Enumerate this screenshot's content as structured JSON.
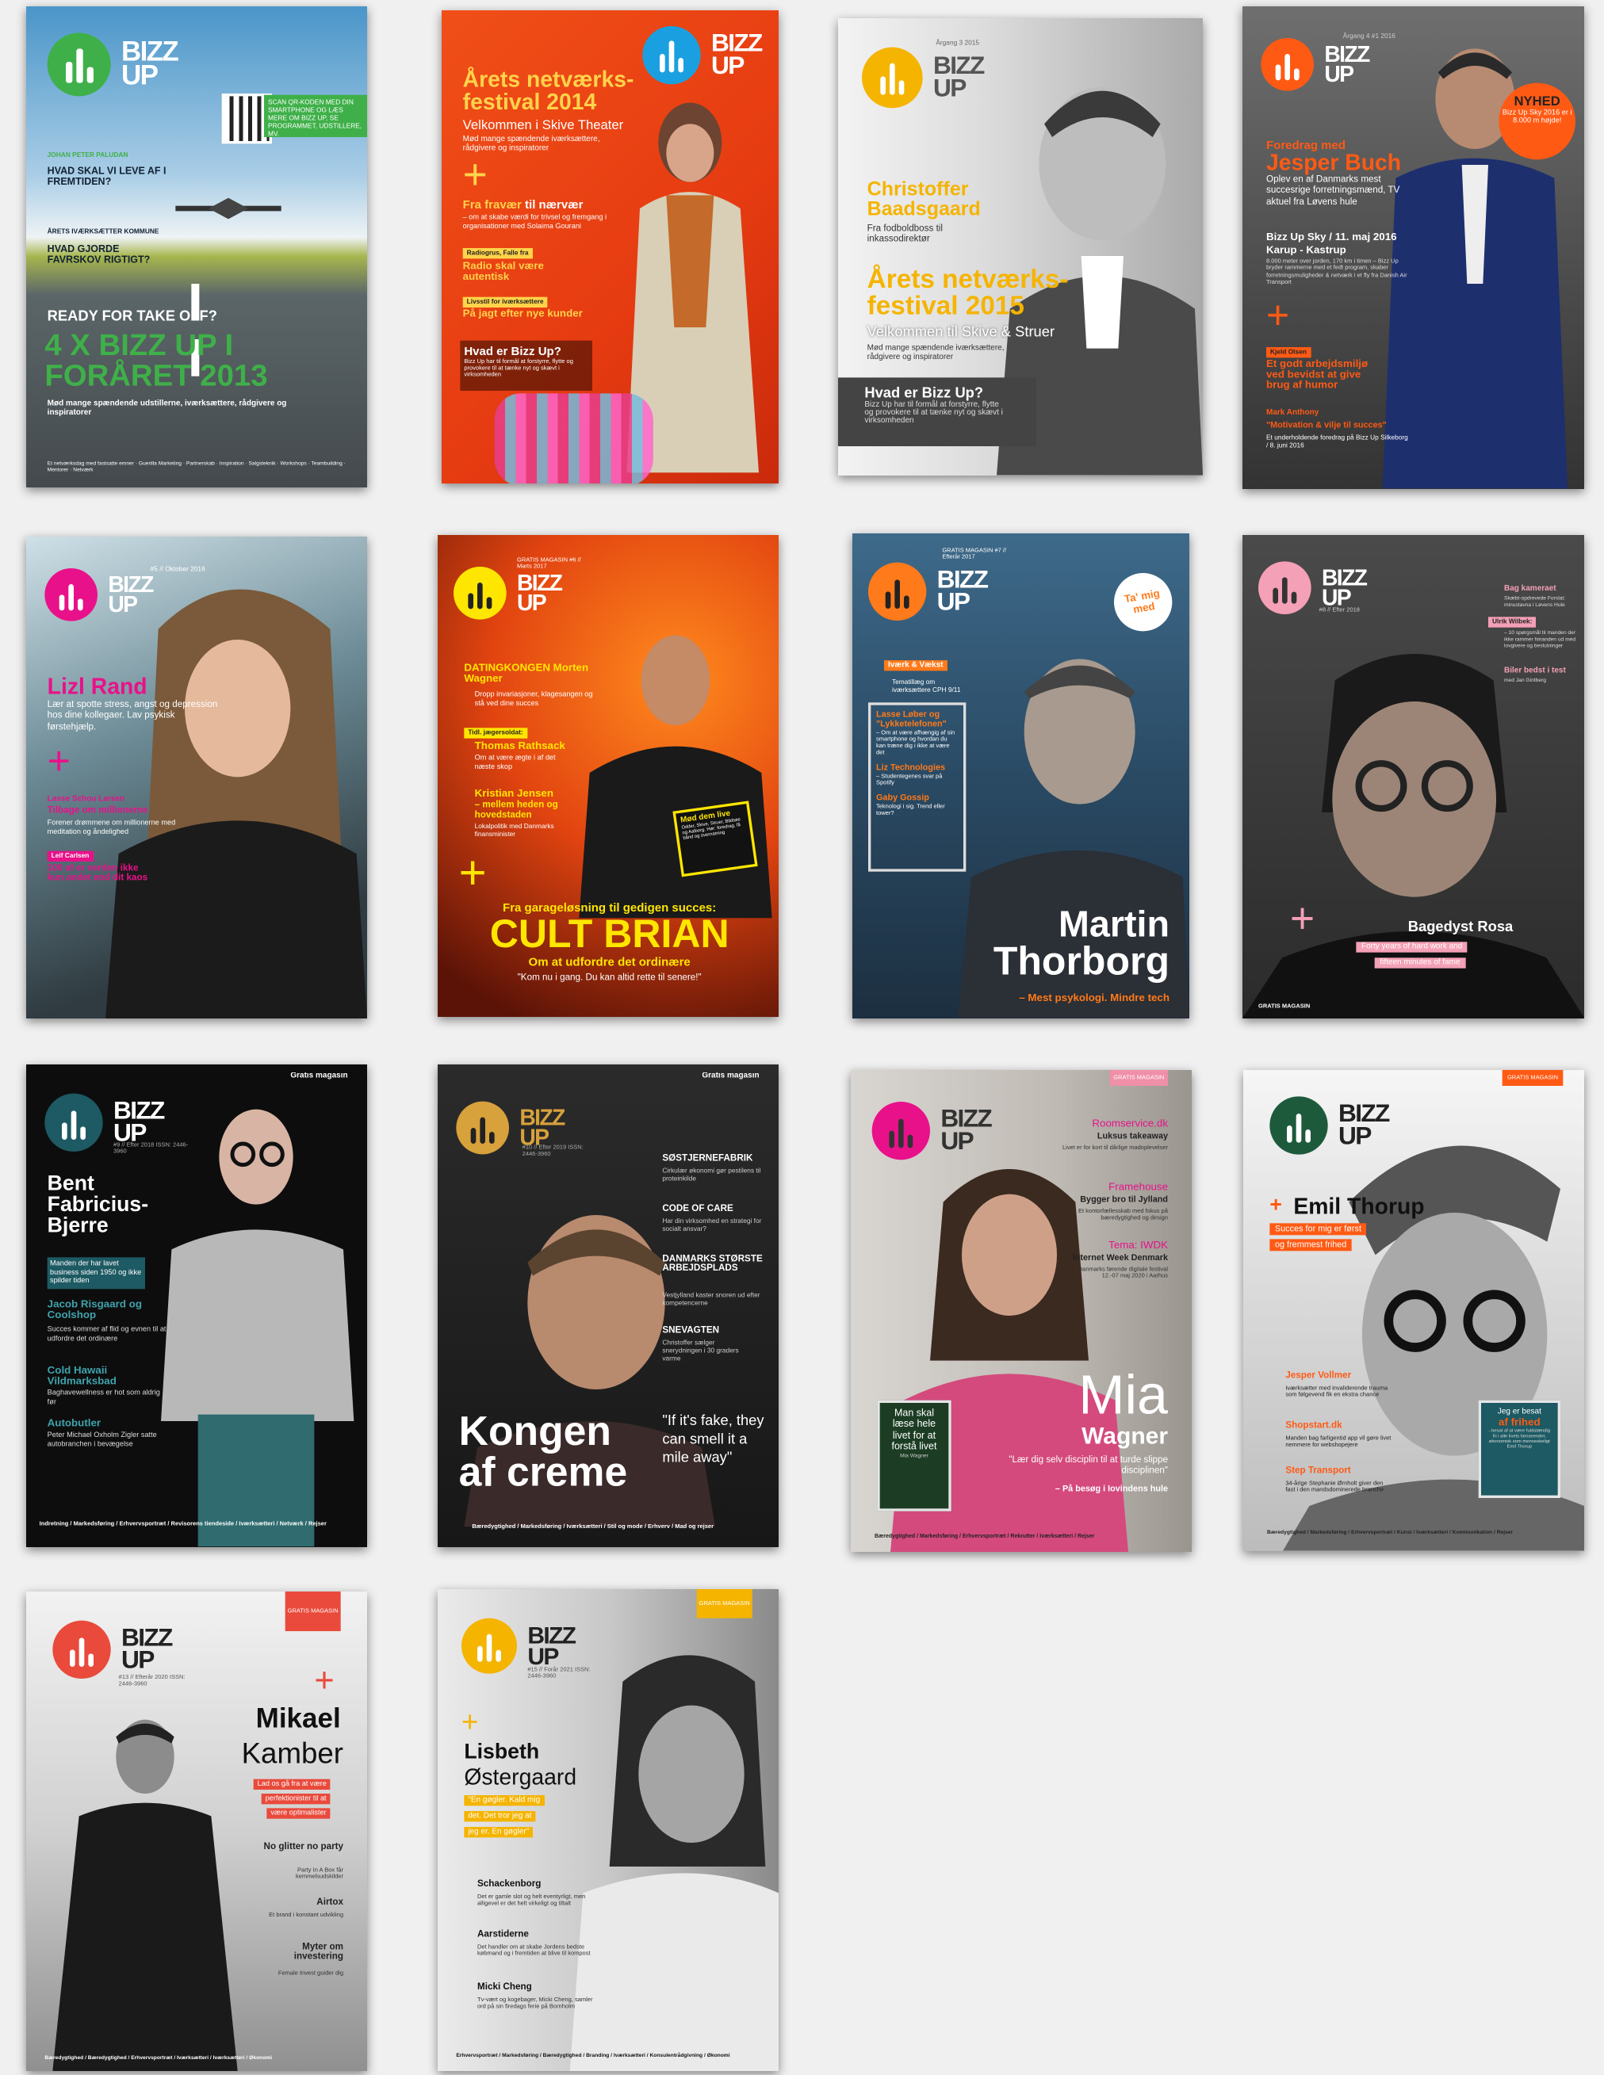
{
  "covers": [
    {
      "logo": "BIZZ\nUP",
      "qr_text": "SCAN QR-KODEN MED DIN SMARTPHONE OG LÆS MERE OM BIZZ UP, SE PROGRAMMET, UDSTILLERE, MV.",
      "byline": "JOHAN PETER PALUDAN",
      "q1": "HVAD SKAL VI LEVE AF I FREMTIDEN?",
      "kicker2": "ÅRETS IVÆRKSÆTTER KOMMUNE",
      "q2": "HVAD GJORDE FAVRSKOV RIGTIGT?",
      "tagline": "READY FOR TAKE OFF?",
      "headline": "4 X BIZZ UP I FORÅRET 2013",
      "sub": "Mød mange spændende udstillerne, iværksættere, rådgivere og inspiratorer",
      "footer": "Et netværksdag med fastsatte emner · Guerilla Marketing · Partnerskab · Inspiration · Salgsteknik · Workshops · Teambuilding · Mentorer · Netværk"
    },
    {
      "logo": "BIZZ\nUP",
      "headline": "Årets netværks-festival 2014",
      "sub": "Velkommen i Skive Theater",
      "sub2": "Mød mange spændende iværksættere, rådgivere og inspiratorer",
      "plus": "+",
      "l1a": "Fra fravær",
      "l1b": " til nærvær",
      "l1c": "– om at skabe værdi for trivsel og fremgang i organisationer med Solaima Gourani",
      "k2": "Radiogrus, Falle fra",
      "l2": "Radio skal være autentisk",
      "k3": "Livsstil for iværksættere",
      "l3": "På jagt efter nye kunder",
      "q": "Hvad er Bizz Up?",
      "qd": "Bizz Up har til formål at forstyrre, flytte og provokere til at tænke nyt og skævt i virksomheden"
    },
    {
      "logo": "BIZZ\nUP",
      "issue": "Årgang 3 2015",
      "name": "Christoffer Baadsgaard",
      "name_sub": "Fra fodboldboss til inkassodirektør",
      "headline": "Årets netværks-festival 2015",
      "sub": "Velkommen til Skive & Struer",
      "sub2": "Mød mange spændende iværksættere, rådgivere og inspiratorer",
      "q": "Hvad er Bizz Up?",
      "qd": "Bizz Up har til formål at forstyrre, flytte og provokere til at tænke nyt og skævt i virksomheden"
    },
    {
      "logo": "BIZZ\nUP",
      "issue": "Årgang 4 #1 2016",
      "badge1": "NYHED",
      "badge2": "Bizz Up Sky 2016 er i 8.000 m højde!",
      "kicker": "Foredrag med",
      "name": "Jesper Buch",
      "desc": "Oplev en af Danmarks mest succesrige forretningsmænd, TV aktuel fra Løvens hule",
      "event": "Bizz Up Sky / 11. maj 2016",
      "place": "Karup - Kastrup",
      "eventd": "8.000 meter over jorden, 170 km i timen – Bizz Up bryder rammerne med et fedt program, skaber forretningsmuligheder & netværk i et fly fra Danish Air Transport",
      "plus": "+",
      "k2": "Kjeld Olsen",
      "l2": "Et godt arbejdsmiljø ved bevidst at give brug af humor",
      "k3": "Mark Anthony",
      "l3": "\"Motivation & vilje til succes\"",
      "l3d": "Et underholdende foredrag på Bizz Up Silkeborg / 8. juni 2016"
    },
    {
      "logo": "BIZZ\nUP",
      "issue": "#5 // Oktober 2016",
      "name": "Lizl Rand",
      "desc": "Lær at spotte stress, angst og depression hos dine kollegaer. Lav psykisk førstehjælp.",
      "plus": "+",
      "k2": "Lasse Schou Larsen",
      "l2": "Tilbage om millionerne",
      "d2": "Forener drømmene om millionerne med meditation og åndelighed",
      "k3": "Leif Carlsen",
      "l3": "100 af er verden ikke kun andet end dit kaos"
    },
    {
      "logo": "BIZZ\nUP",
      "issue": "GRATIS MAGASIN #6 // Marts 2017",
      "l1": "DATINGKONGEN Morten Wagner",
      "l1d": "Dropp invariasjoner, klagesangen og stå ved dine succes",
      "k2": "Tidl. jægersoldat:",
      "l2": "Thomas Rathsack",
      "l2d": "Om at være ægte i af det næste skop",
      "l3": "Kristian Jensen",
      "l3b": "– mellem heden og hovedstaden",
      "l3d": "Lokalpolitik med Danmarks finansminister",
      "meet": "Mød dem live",
      "meetd": "Odder, Skive, Struer, Bildsøe og Aalborg. Hør: foredrag, få bånd og overnatning",
      "plus": "+",
      "kicker": "Fra garageløsning til gedigen succes:",
      "headline": "CULT BRIAN",
      "sub": "Om at udfordre det ordinære",
      "quote": "\"Kom nu i gang. Du kan altid rette til senere!\""
    },
    {
      "logo": "BIZZ\nUP",
      "issue": "GRATIS MAGASIN #7 // Efterår 2017",
      "sticker": "Ta' mig med",
      "k1": "Iværk & Vækst",
      "l1d": "Tematillæg om iværksættere CPH 9/11",
      "l2": "Lasse Løber og \"Lykketelefonen\"",
      "l2d": "– Om at være afhængig af sin smartphone og hvordan du kan træne dig i ikke at være det",
      "l3": "Liz Technologies",
      "l3d": "– Studentegenes svar på Spotify",
      "l4": "Gaby Gossip",
      "l4d": "Teknologi i sig. Trend eller tower?",
      "name1": "Martin",
      "name2": "Thorborg",
      "sub": "– Mest psykologi. Mindre tech"
    },
    {
      "logo": "BIZZ\nUP",
      "issue": "#8 // Efter 2018",
      "k1": "Bag kameraet",
      "l1d": "Skæbt-opdrevede Forslat: minustavna i Løvens Hule",
      "k2": "Ulrik Wilbek:",
      "l2d": "– 10 spørgsmål til manden der ikke rammer hinanden ud med lovgivere og beslutninger",
      "k3": "Biler bedst i test",
      "l3d": "med Jan Gintberg",
      "plus": "+",
      "name": "Bagedyst Rosa",
      "tag1": "Forty years of hard work and",
      "tag2": "fifteen minutes of fame",
      "footer": "GRATIS MAGASIN"
    },
    {
      "logo": "BIZZ\nUP",
      "issue": "#9 // Efter 2018 ISSN: 2446-3960",
      "top": "Gratis magasin",
      "name": "Bent Fabricius-Bjerre",
      "tag": "Manden der har lavet business siden 1950 og ikke spilder tiden",
      "l2": "Jacob Risgaard og Coolshop",
      "l2d": "Succes kommer af flid og evnen til at udfordre det ordinære",
      "l3": "Cold Hawaii Vildmarksbad",
      "l3d": "Baghavewellness er hot som aldrig før",
      "l4": "Autobutler",
      "l4d": "Peter Michael Oxholm Zigler satte autobranchen i bevægelse",
      "nav": "Indretning / Markedsføring / Erhvervsportræt / Revisorens tiendeside / Iværksætteri / Netværk / Rejser"
    },
    {
      "logo": "BIZZ\nUP",
      "issue": "#10 // Efter 2019 ISSN: 2446-3960",
      "top": "Gratis magasin",
      "l1": "SØSTJERNEFABRIK",
      "l1d": "Cirkulær økonomi gør pestilens til proteinkilde",
      "l2": "CODE OF CARE",
      "l2d": "Har din virksomhed en strategi for socialt ansvar?",
      "l3": "DANMARKS STØRSTE ARBEJDSPLADS",
      "l3d": "Vestjylland kaster snoren ud efter kompetencerne",
      "l4": "SNEVAGTEN",
      "l4d": "Christoffer sælger snerydningen i 30 graders varme",
      "headline": "Kongen af creme",
      "quote": "\"If it's fake, they can smell it a mile away\"",
      "nav": "Bæredygtighed / Markedsføring / Iværksætteri / Stil og mode / Erhverv / Mad og rejser"
    },
    {
      "logo": "BIZZ\nUP",
      "top": "GRATIS MAGASIN",
      "k1": "Roomservice.dk",
      "l1": "Luksus takeaway",
      "l1d": "Livet er for kort til dårlige madoplevelser",
      "k2": "Framehouse",
      "l2": "Bygger bro til Jylland",
      "l2d": "Et kontorfællesskab med fokus på bæredygtighed og design",
      "k3": "Tema: IWDK",
      "l3": "Internet Week Denmark",
      "l3d": "Danmarks førende digitale festival 12.-07 maj 2020 i Aarhus",
      "box": "Man skal læse hele livet for at forstå livet",
      "boxd": "Mia Wagner",
      "name1": "Mia",
      "name2": "Wagner",
      "quote": "\"Lær dig selv disciplin til at turde slippe disciplinen\"",
      "sub": "– På besøg i Iovindens hule",
      "nav": "Bæredygtighed / Markedsføring / Erhvervsportræt / Rekrutter / Iværksætteri / Rejser"
    },
    {
      "logo": "BIZZ\nUP",
      "top": "GRATIS MAGASIN",
      "name": "Emil Thorup",
      "tag1": "Succes for mig er først",
      "tag2": "og fremmest frihed",
      "l1": "Jesper Vollmer",
      "l1d": "Iværksætter med invaliderende trauma som følgevend fik en ekstra chance",
      "l2": "Shopstart.dk",
      "l2d": "Manden bag farligentid app vil gøre livet nemmere for webshopejere",
      "l3": "Step Transport",
      "l3d": "34-årige Stephanie Ørnholt giver den fast i den mandsdominerede branche",
      "box1": "Jeg er besat",
      "box2": "af frihed",
      "boxd": "- besat af at være fuldstændig fri i alle livets henseender, økonomisk som menneskeligt",
      "boxf": "Emil Thorup",
      "nav": "Bæredygtighed / Markedsføring / Erhvervsportræt / Kunst / Iværksætteri / Kommunikation / Rejser"
    },
    {
      "logo": "BIZZ\nUP",
      "issue": "#13 // Efterår 2020 ISSN: 2446-3960",
      "top": "GRATIS MAGASIN",
      "plus": "+",
      "name1": "Mikael",
      "name2": "Kamber",
      "tag1": "Lad os gå fra at være",
      "tag2": "perfektionister til at",
      "tag3": "være optimalister",
      "l1": "No glitter no party",
      "l1d": "Party In A Box får kemmelsudskilder",
      "l2": "Airtox",
      "l2d": "Et brand i konstant udvikling",
      "l3": "Myter om investering",
      "l3d": "Female Invest guider dig",
      "nav": "Bæredygtighed / Bæredygtighed / Erhvervsportræt / Iværksætteri / Iværksætteri / Økonomi"
    },
    {
      "logo": "BIZZ\nUP",
      "issue": "#15 // Forår 2021 ISSN: 2446-3960",
      "top": "GRATIS MAGASIN",
      "plus": "+",
      "name1": "Lisbeth",
      "name2": "Østergaard",
      "tag1": "\"En gøgler. Kald mig",
      "tag2": "det. Det tror jeg at",
      "tag3": "jeg er. En gøgler\"",
      "l1": "Schackenborg",
      "l1d": "Det er gamle slot og helt eventyrligt, men alligevel er det helt virkeligt og tiltalt",
      "l2": "Aarstiderne",
      "l2d": "Det handler om at skabe Jordens bedste købmand og i fremtiden at blive til kompost",
      "l3": "Micki Cheng",
      "l3d": "Tv-vært og kogebager, Micki Cheng, samler ord på sin firedags ferie på Bornholm",
      "nav": "Erhvervsportræt / Markedsføring / Bæredygtighed / Branding / Iværksætteri / Konsulentrådgivning / Økonomi"
    }
  ],
  "colors": {
    "green": "#3fb049",
    "blue": "#1aa0e0",
    "yellow": "#f5b400",
    "orange": "#ff5a14",
    "magenta": "#e8118a",
    "teal": "#1d5a63",
    "pink": "#f4a0b6",
    "red": "#e94a3c",
    "gold": "#d7a13b"
  }
}
